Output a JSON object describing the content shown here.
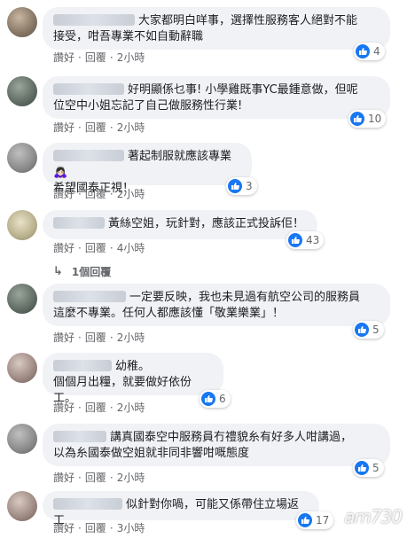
{
  "comments": [
    {
      "text_line1": "大家都明白咩事，選擇性服務客人絕對不能",
      "text_line2": "接受，咁吾專業不如自動辭職",
      "like": "讚好",
      "reply": "回覆",
      "time": "2小時",
      "reactions": "4"
    },
    {
      "text_line1": "好明顯係乜事! 小學雞既事YC最鍾意做，但呢",
      "text_line2": "位空中小姐忘記了自己做服務性行業!",
      "like": "讚好",
      "reply": "回覆",
      "time": "2小時",
      "reactions": "10"
    },
    {
      "text_line1": "著起制服就應該專業🙇🏻‍♀️",
      "text_line2": "希望國泰正視！",
      "like": "讚好",
      "reply": "回覆",
      "time": "2小時",
      "reactions": "3"
    },
    {
      "text_line1": "黃絲空姐，玩針對，應該正式投訴佢！",
      "text_line2": "",
      "like": "讚好",
      "reply": "回覆",
      "time": "4小時",
      "reactions": "43"
    },
    {
      "text_line1": "一定要反映，我也未見過有航空公司的服務員",
      "text_line2": "這麼不專業。任何人都應該懂「敬業樂業」！",
      "like": "讚好",
      "reply": "回覆",
      "time": "2小時",
      "reactions": "5"
    },
    {
      "text_line1": "幼稚。",
      "text_line2": "個個月出糧，就要做好依份工。",
      "like": "讚好",
      "reply": "回覆",
      "time": "2小時",
      "reactions": "6"
    },
    {
      "text_line1": "講真國泰空中服務員冇禮貌糸有好多人咁講過，",
      "text_line2": "以為糸國泰做空姐就非同非響咁嘅態度",
      "like": "讚好",
      "reply": "回覆",
      "time": "2小時",
      "reactions": "5"
    },
    {
      "text_line1": "似針對你喎，可能又係帶住立場返工",
      "text_line2": "",
      "like": "讚好",
      "reply": "回覆",
      "time": "3小時",
      "reactions": "17"
    }
  ],
  "reply_thread": {
    "label": "1個回覆"
  },
  "watermark": "am730",
  "colors": {
    "like_blue": "#1877f2",
    "bubble_bg": "#f0f2f5",
    "meta_gray": "#65676b"
  }
}
